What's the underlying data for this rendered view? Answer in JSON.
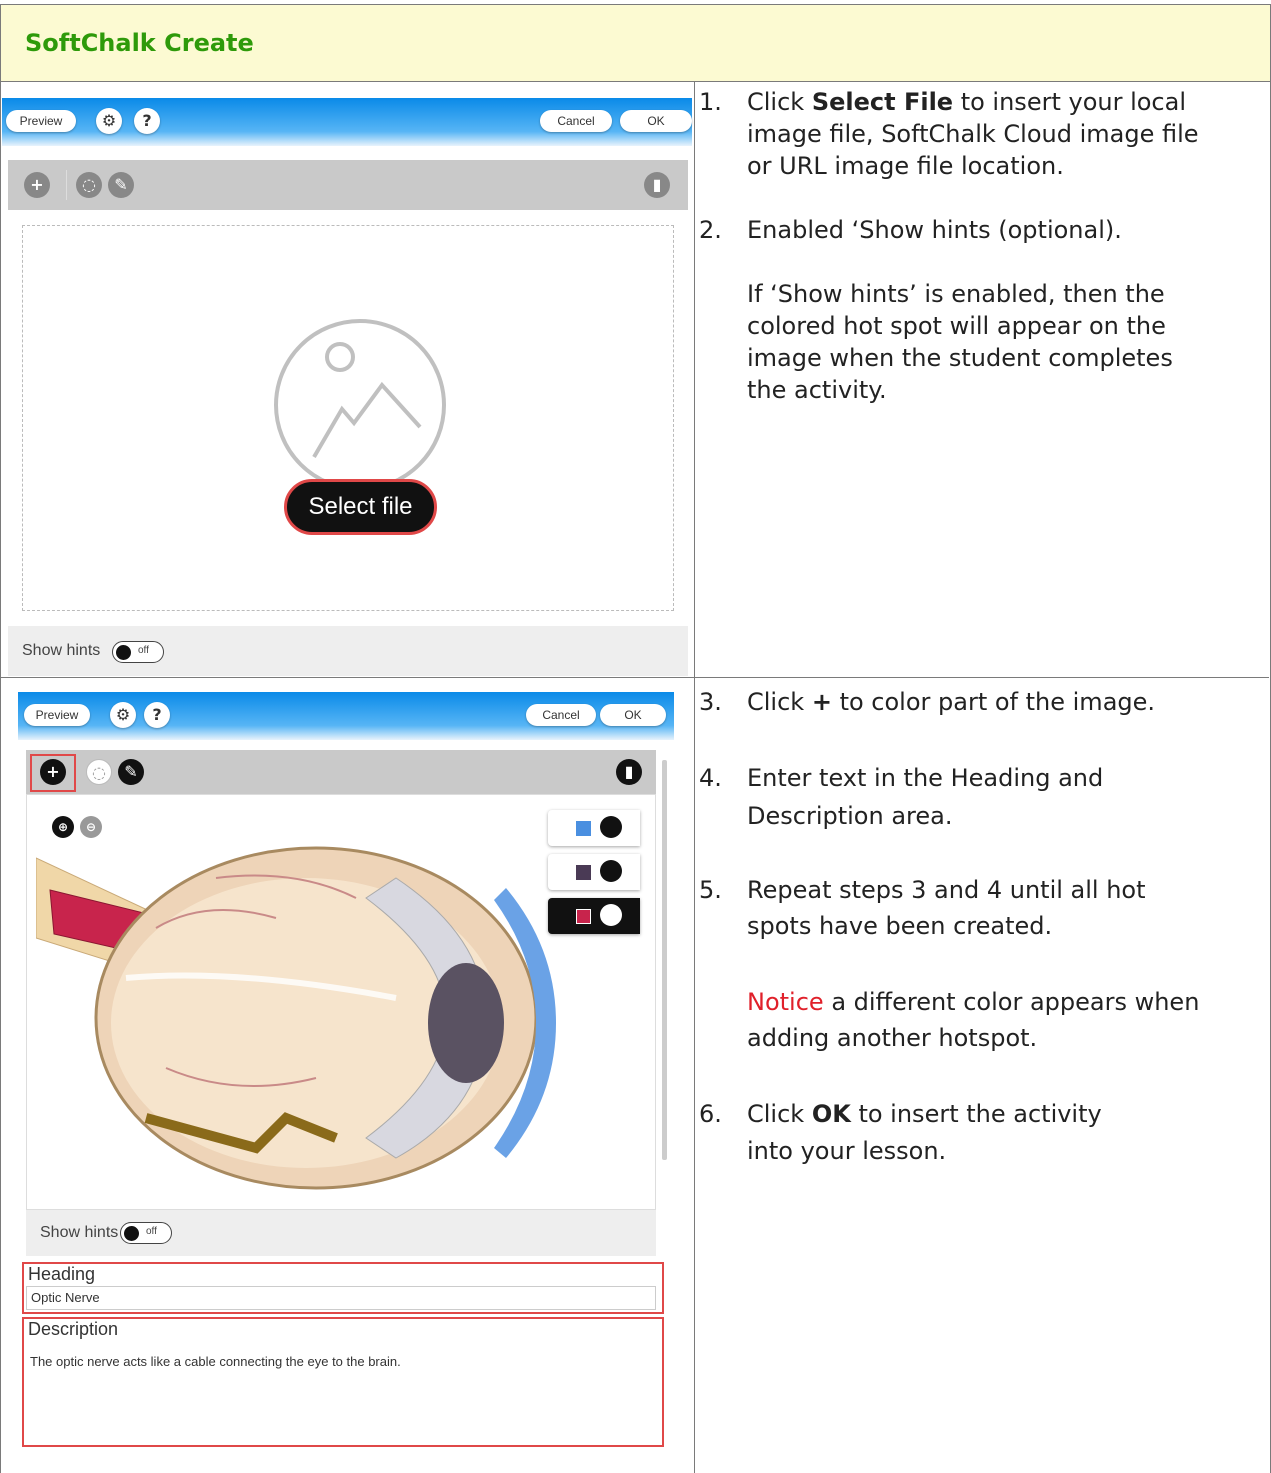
{
  "title": "SoftChalk Create",
  "screenshot1": {
    "preview": "Preview",
    "gear": "⚙",
    "help": "?",
    "cancel": "Cancel",
    "ok": "OK",
    "select_file": "Select file",
    "show_hints": "Show hints",
    "toggle_off": "off"
  },
  "screenshot2": {
    "preview": "Preview",
    "gear": "⚙",
    "help": "?",
    "cancel": "Cancel",
    "ok": "OK",
    "show_hints": "Show hints",
    "toggle_off": "off",
    "heading_label": "Heading",
    "heading_value": "Optic Nerve",
    "description_label": "Description",
    "description_value": "The optic nerve acts like a cable connecting the eye to the brain.",
    "swatch_colors": [
      "#4a8fe0",
      "#4a3a55",
      "#c8244c"
    ]
  },
  "steps": {
    "s1_num": "1.",
    "s1_a": "Click ",
    "s1_b": "Select File",
    "s1_c": " to insert your local",
    "s1_l2": "image file, SoftChalk Cloud image file",
    "s1_l3": "or URL image file location.",
    "s2_num": "2.",
    "s2_text": "Enabled ‘Show hints (optional).",
    "s2_n1": "If ‘Show hints’ is enabled, then the",
    "s2_n2": "colored hot spot will appear on the",
    "s2_n3": "image when the student completes",
    "s2_n4": "the activity.",
    "s3_num": "3.",
    "s3_a": "Click ",
    "s3_b": "+",
    "s3_c": " to color part of the image.",
    "s4_num": "4.",
    "s4_l1": "Enter text in the Heading and",
    "s4_l2": "Description area.",
    "s5_num": "5.",
    "s5_l1": "Repeat steps 3 and 4 until all hot",
    "s5_l2": "spots have been created.",
    "n5_red": "Notice",
    "n5_rest": " a different color appears when",
    "n5_l2": "adding another hotspot.",
    "s6_num": "6.",
    "s6_a": "Click ",
    "s6_b": "OK",
    "s6_c": " to insert the activity",
    "s6_l2": "into your lesson."
  }
}
